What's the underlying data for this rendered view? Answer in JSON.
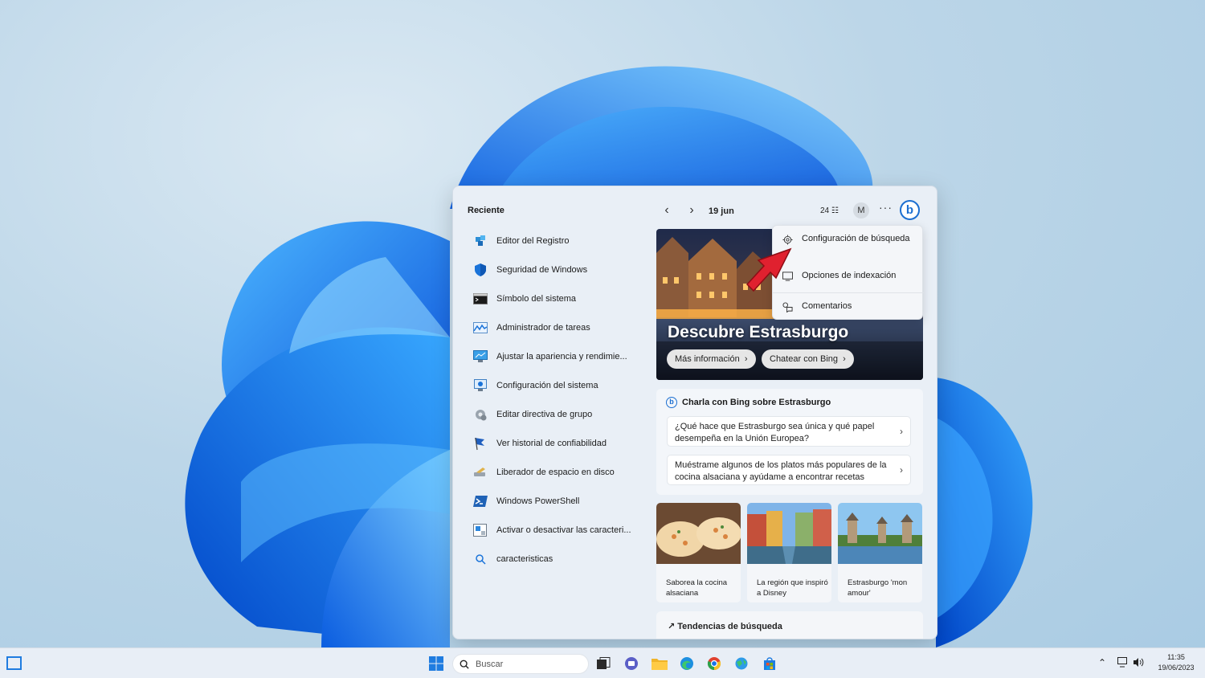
{
  "search_panel": {
    "recent_title": "Reciente",
    "recent_items": [
      {
        "label": "Editor del Registro",
        "icon": "registry-editor-icon"
      },
      {
        "label": "Seguridad de Windows",
        "icon": "shield-icon"
      },
      {
        "label": "Símbolo del sistema",
        "icon": "command-prompt-icon"
      },
      {
        "label": "Administrador de tareas",
        "icon": "task-manager-icon"
      },
      {
        "label": "Ajustar la apariencia y rendimie...",
        "icon": "performance-icon"
      },
      {
        "label": "Configuración del sistema",
        "icon": "system-config-icon"
      },
      {
        "label": "Editar directiva de grupo",
        "icon": "group-policy-icon"
      },
      {
        "label": "Ver historial de confiabilidad",
        "icon": "reliability-icon"
      },
      {
        "label": "Liberador de espacio en disco",
        "icon": "disk-cleanup-icon"
      },
      {
        "label": "Windows PowerShell",
        "icon": "powershell-icon"
      },
      {
        "label": "Activar o desactivar las caracteri...",
        "icon": "windows-features-icon"
      },
      {
        "label": "caracteristicas",
        "icon": "search-icon"
      }
    ],
    "date": "19 jun",
    "points": "24",
    "avatar_initial": "M",
    "more_label": "···",
    "bing_label": "b",
    "hero": {
      "title": "Descubre Estrasburgo",
      "btn_more": "Más información",
      "btn_chat": "Chatear con Bing"
    },
    "context_menu": {
      "items": [
        {
          "label": "Configuración de búsqueda",
          "icon": "gear-icon"
        },
        {
          "label": "Opciones de indexación",
          "icon": "indexing-icon"
        },
        {
          "label": "Comentarios",
          "icon": "feedback-icon"
        }
      ]
    },
    "chat_card": {
      "title": "Charla con Bing sobre Estrasburgo",
      "questions": [
        "¿Qué hace que Estrasburgo sea única y qué papel desempeña en la Unión Europea?",
        "Muéstrame algunos de los platos más populares de la cocina alsaciana y ayúdame a encontrar recetas"
      ]
    },
    "thumbs": [
      {
        "caption": "Saborea la cocina alsaciana"
      },
      {
        "caption": "La región que inspiró a Disney"
      },
      {
        "caption": "Estrasburgo 'mon amour'"
      }
    ],
    "trending_title": "Tendencias de búsqueda"
  },
  "taskbar": {
    "search_placeholder": "Buscar",
    "clock_time": "11:35",
    "clock_date": "19/06/2023"
  },
  "colors": {
    "accent": "#1f7ce0",
    "bing_blue": "#1c6fd1",
    "arrow_red": "#e0212f"
  }
}
